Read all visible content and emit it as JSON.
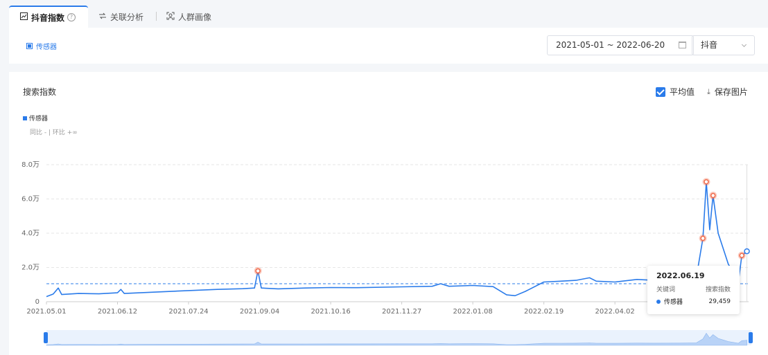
{
  "tabs": [
    {
      "label": "抖音指数",
      "help": "?"
    },
    {
      "label": "关联分析"
    },
    {
      "label": "人群画像"
    }
  ],
  "filter": {
    "keyword": "传感器",
    "date_range": "2021-05-01 ~ 2022-06-20",
    "platform": "抖音"
  },
  "panel": {
    "title": "搜索指数",
    "avg_label": "平均值",
    "save_label": "保存图片",
    "legend": "传感器",
    "compare": "同比 - | 环比 +∞"
  },
  "tooltip": {
    "date": "2022.06.19",
    "col_keyword": "关键词",
    "col_value": "搜索指数",
    "keyword": "传感器",
    "value": "29,459"
  },
  "colors": {
    "accent": "#2a7bea",
    "highlight": "#f06a4a"
  },
  "chart_data": {
    "type": "line",
    "title": "搜索指数",
    "y_tick_labels": [
      "0",
      "2.0万",
      "4.0万",
      "6.0万",
      "8.0万"
    ],
    "ylim": [
      0,
      80000
    ],
    "x_tick_labels": [
      "2021.05.01",
      "2021.06.12",
      "2021.07.24",
      "2021.09.04",
      "2021.10.16",
      "2021.11.27",
      "2022.01.08",
      "2022.02.19",
      "2022.04.02"
    ],
    "average": 10500,
    "series": [
      {
        "name": "传感器",
        "points": [
          [
            "2021-05-01",
            3000
          ],
          [
            "2021-05-05",
            4500
          ],
          [
            "2021-05-08",
            8000
          ],
          [
            "2021-05-10",
            4200
          ],
          [
            "2021-05-20",
            4800
          ],
          [
            "2021-06-01",
            4600
          ],
          [
            "2021-06-12",
            5200
          ],
          [
            "2021-06-14",
            7200
          ],
          [
            "2021-06-16",
            4800
          ],
          [
            "2021-07-01",
            5500
          ],
          [
            "2021-07-24",
            6500
          ],
          [
            "2021-08-10",
            7200
          ],
          [
            "2021-08-25",
            7600
          ],
          [
            "2021-09-01",
            8000
          ],
          [
            "2021-09-03",
            18000
          ],
          [
            "2021-09-05",
            8000
          ],
          [
            "2021-09-15",
            7500
          ],
          [
            "2021-10-01",
            8000
          ],
          [
            "2021-10-16",
            8300
          ],
          [
            "2021-11-01",
            8200
          ],
          [
            "2021-11-27",
            8700
          ],
          [
            "2021-12-15",
            9000
          ],
          [
            "2021-12-20",
            10500
          ],
          [
            "2021-12-25",
            9000
          ],
          [
            "2022-01-08",
            9500
          ],
          [
            "2022-01-20",
            8800
          ],
          [
            "2022-01-28",
            4000
          ],
          [
            "2022-02-02",
            3500
          ],
          [
            "2022-02-08",
            6000
          ],
          [
            "2022-02-19",
            11500
          ],
          [
            "2022-03-01",
            12000
          ],
          [
            "2022-03-10",
            12500
          ],
          [
            "2022-03-18",
            14000
          ],
          [
            "2022-03-22",
            12000
          ],
          [
            "2022-04-02",
            11500
          ],
          [
            "2022-04-15",
            13000
          ],
          [
            "2022-04-25",
            12500
          ],
          [
            "2022-05-10",
            13000
          ],
          [
            "2022-05-20",
            13500
          ],
          [
            "2022-05-24",
            37000
          ],
          [
            "2022-05-26",
            70000
          ],
          [
            "2022-05-28",
            42000
          ],
          [
            "2022-05-30",
            62000
          ],
          [
            "2022-06-02",
            40000
          ],
          [
            "2022-06-05",
            31000
          ],
          [
            "2022-06-08",
            22000
          ],
          [
            "2022-06-11",
            17000
          ],
          [
            "2022-06-14",
            12000
          ],
          [
            "2022-06-16",
            27000
          ],
          [
            "2022-06-18",
            28500
          ],
          [
            "2022-06-19",
            29459
          ]
        ],
        "highlights": [
          "2021-09-03",
          "2022-05-24",
          "2022-05-26",
          "2022-05-30",
          "2022-06-16"
        ]
      }
    ],
    "grid": true,
    "legend_position": "top-left"
  }
}
